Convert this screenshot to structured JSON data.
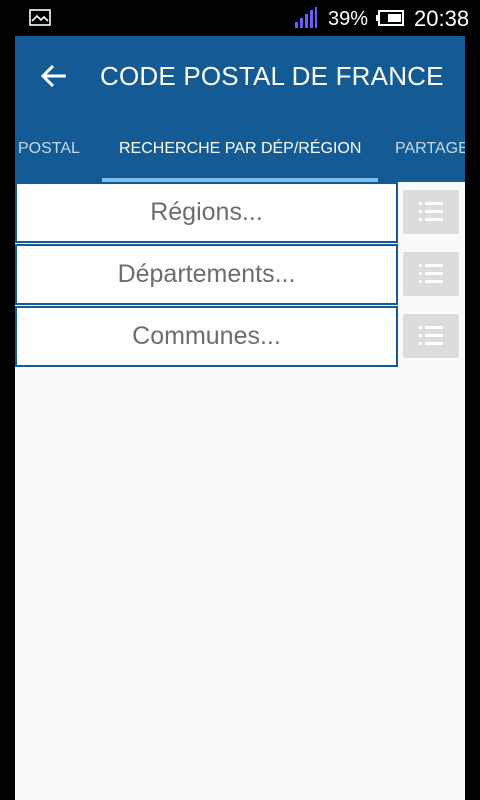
{
  "status_bar": {
    "battery_percent": "39%",
    "time": "20:38",
    "icons": [
      "gallery-icon",
      "signal-icon",
      "battery-icon"
    ]
  },
  "app_bar": {
    "title": "CODE POSTAL DE FRANCE",
    "back_icon": "arrow-left-icon"
  },
  "tabs": [
    {
      "label": "POSTAL",
      "active": false
    },
    {
      "label": "RECHERCHE PAR DÉP/RÉGION",
      "active": true
    },
    {
      "label": "PARTAGE",
      "active": false
    }
  ],
  "fields": [
    {
      "placeholder": "Régions...",
      "button_icon": "list-icon"
    },
    {
      "placeholder": "Départements...",
      "button_icon": "list-icon"
    },
    {
      "placeholder": "Communes...",
      "button_icon": "list-icon"
    }
  ],
  "colors": {
    "primary": "#145a94",
    "tab_indicator": "#7fbff0",
    "button_bg": "#dcdcdc",
    "background": "#fafafa",
    "signal": "#6a5cff"
  }
}
